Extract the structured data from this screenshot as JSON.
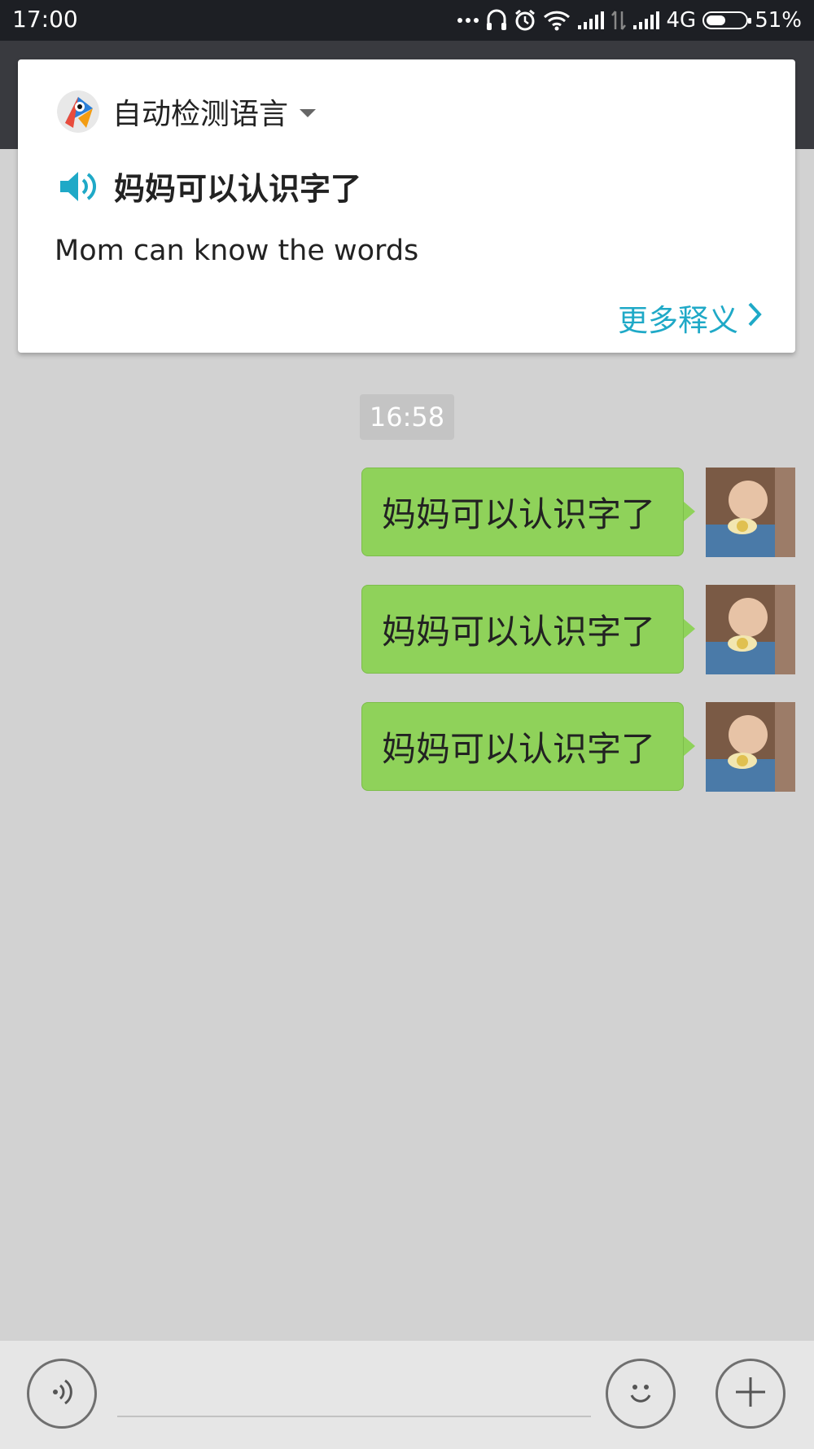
{
  "status_bar": {
    "time": "17:00",
    "network": "4G",
    "battery": "51%",
    "battery_level": 0.51,
    "icons": [
      "more-dots-icon",
      "headset-icon",
      "alarm-icon",
      "wifi-icon",
      "signal-icon",
      "data-arrows-icon",
      "signal-icon",
      "battery-icon"
    ]
  },
  "translate_card": {
    "language_selector": "自动检测语言",
    "source_text": "妈妈可以认识字了",
    "translation": "Mom can know the words",
    "more_link": "更多释义",
    "accent_color": "#1fa9c7"
  },
  "chat": {
    "timestamp": "16:58",
    "bubble_color": "#8fd25a",
    "messages": [
      {
        "text": "妈妈可以认识字了"
      },
      {
        "text": "妈妈可以认识字了"
      },
      {
        "text": "妈妈可以认识字了"
      }
    ]
  },
  "input_bar": {
    "placeholder": ""
  }
}
